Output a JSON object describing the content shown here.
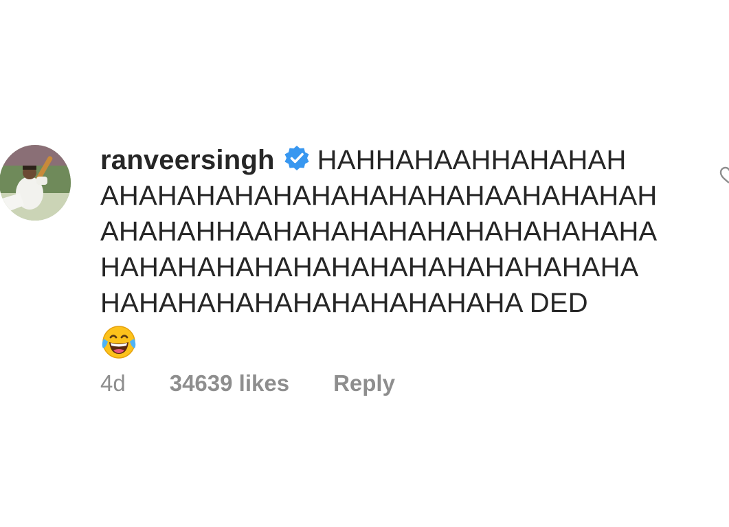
{
  "comment": {
    "username": "ranveersingh",
    "verified_icon": "verified-badge-icon",
    "verified_color": "#3897f0",
    "lines": [
      "HAHHAHAAHHAHAHAH",
      "AHAHAHAHAHAHAHAHAHAHAAHAHAHAH",
      "AHAHAHHAAHAHAHAHAHAHAHAHAHAHA",
      "HAHAHAHAHAHAHAHAHAHAHAHAHAHA",
      "HAHAHAHAHAHAHAHAHAHAHA DED"
    ],
    "emoji": "face-with-tears-of-joy-icon",
    "time": "4d",
    "likes": "34639 likes",
    "reply_label": "Reply",
    "like_icon": "heart-icon"
  },
  "colors": {
    "text": "#262626",
    "meta": "#8e8e8e",
    "background": "#ffffff"
  }
}
